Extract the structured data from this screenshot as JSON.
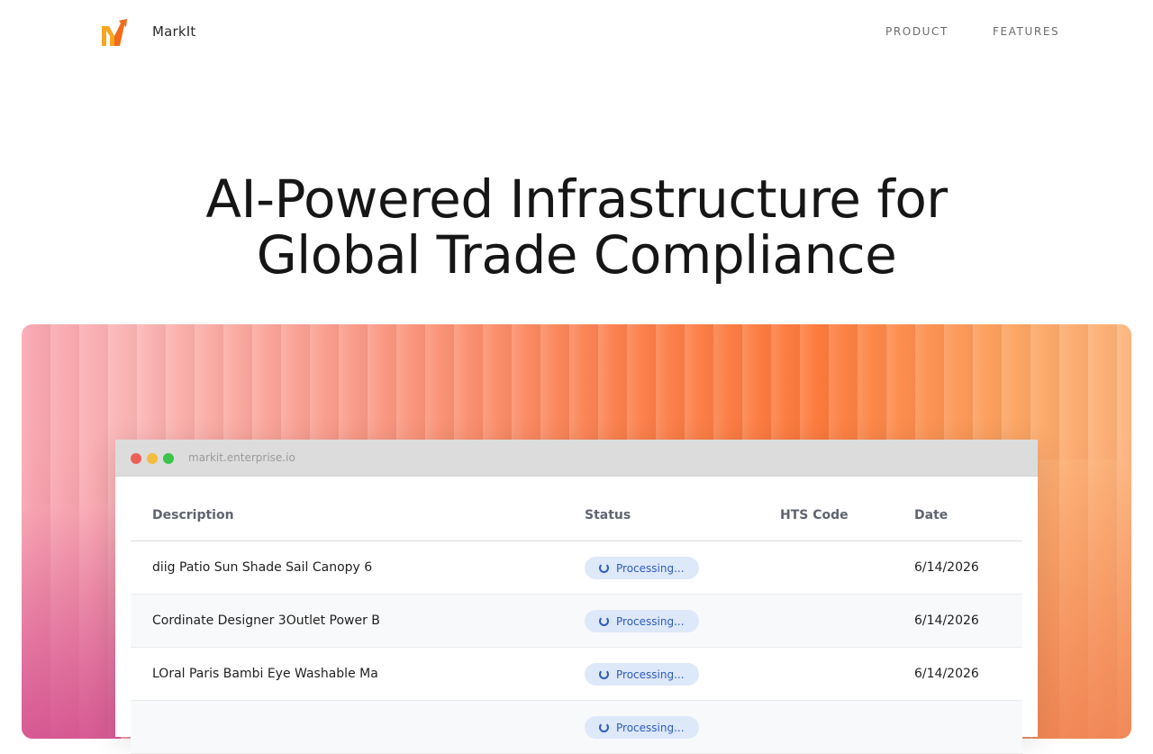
{
  "nav": {
    "brand": "MarkIt",
    "links": [
      "PRODUCT",
      "FEATURES"
    ]
  },
  "hero": {
    "line1": "AI-Powered Infrastructure for",
    "line2": "Global Trade Compliance"
  },
  "window": {
    "url": "markit.enterprise.io"
  },
  "table": {
    "headers": [
      "Description",
      "Status",
      "HTS Code",
      "Date"
    ],
    "rows": [
      {
        "description": "diig Patio Sun Shade Sail Canopy 6",
        "status": "Processing...",
        "hts": "",
        "date": "6/14/2026"
      },
      {
        "description": "Cordinate Designer 3Outlet Power B",
        "status": "Processing...",
        "hts": "",
        "date": "6/14/2026"
      },
      {
        "description": "LOral Paris Bambi Eye Washable Ma",
        "status": "Processing...",
        "hts": "",
        "date": "6/14/2026"
      },
      {
        "description": "",
        "status": "Processing...",
        "hts": "",
        "date": ""
      }
    ]
  },
  "colors": {
    "accent": "#fd7a3c",
    "status_text": "#2e5cb8",
    "status_bg": "#dde8f9"
  }
}
